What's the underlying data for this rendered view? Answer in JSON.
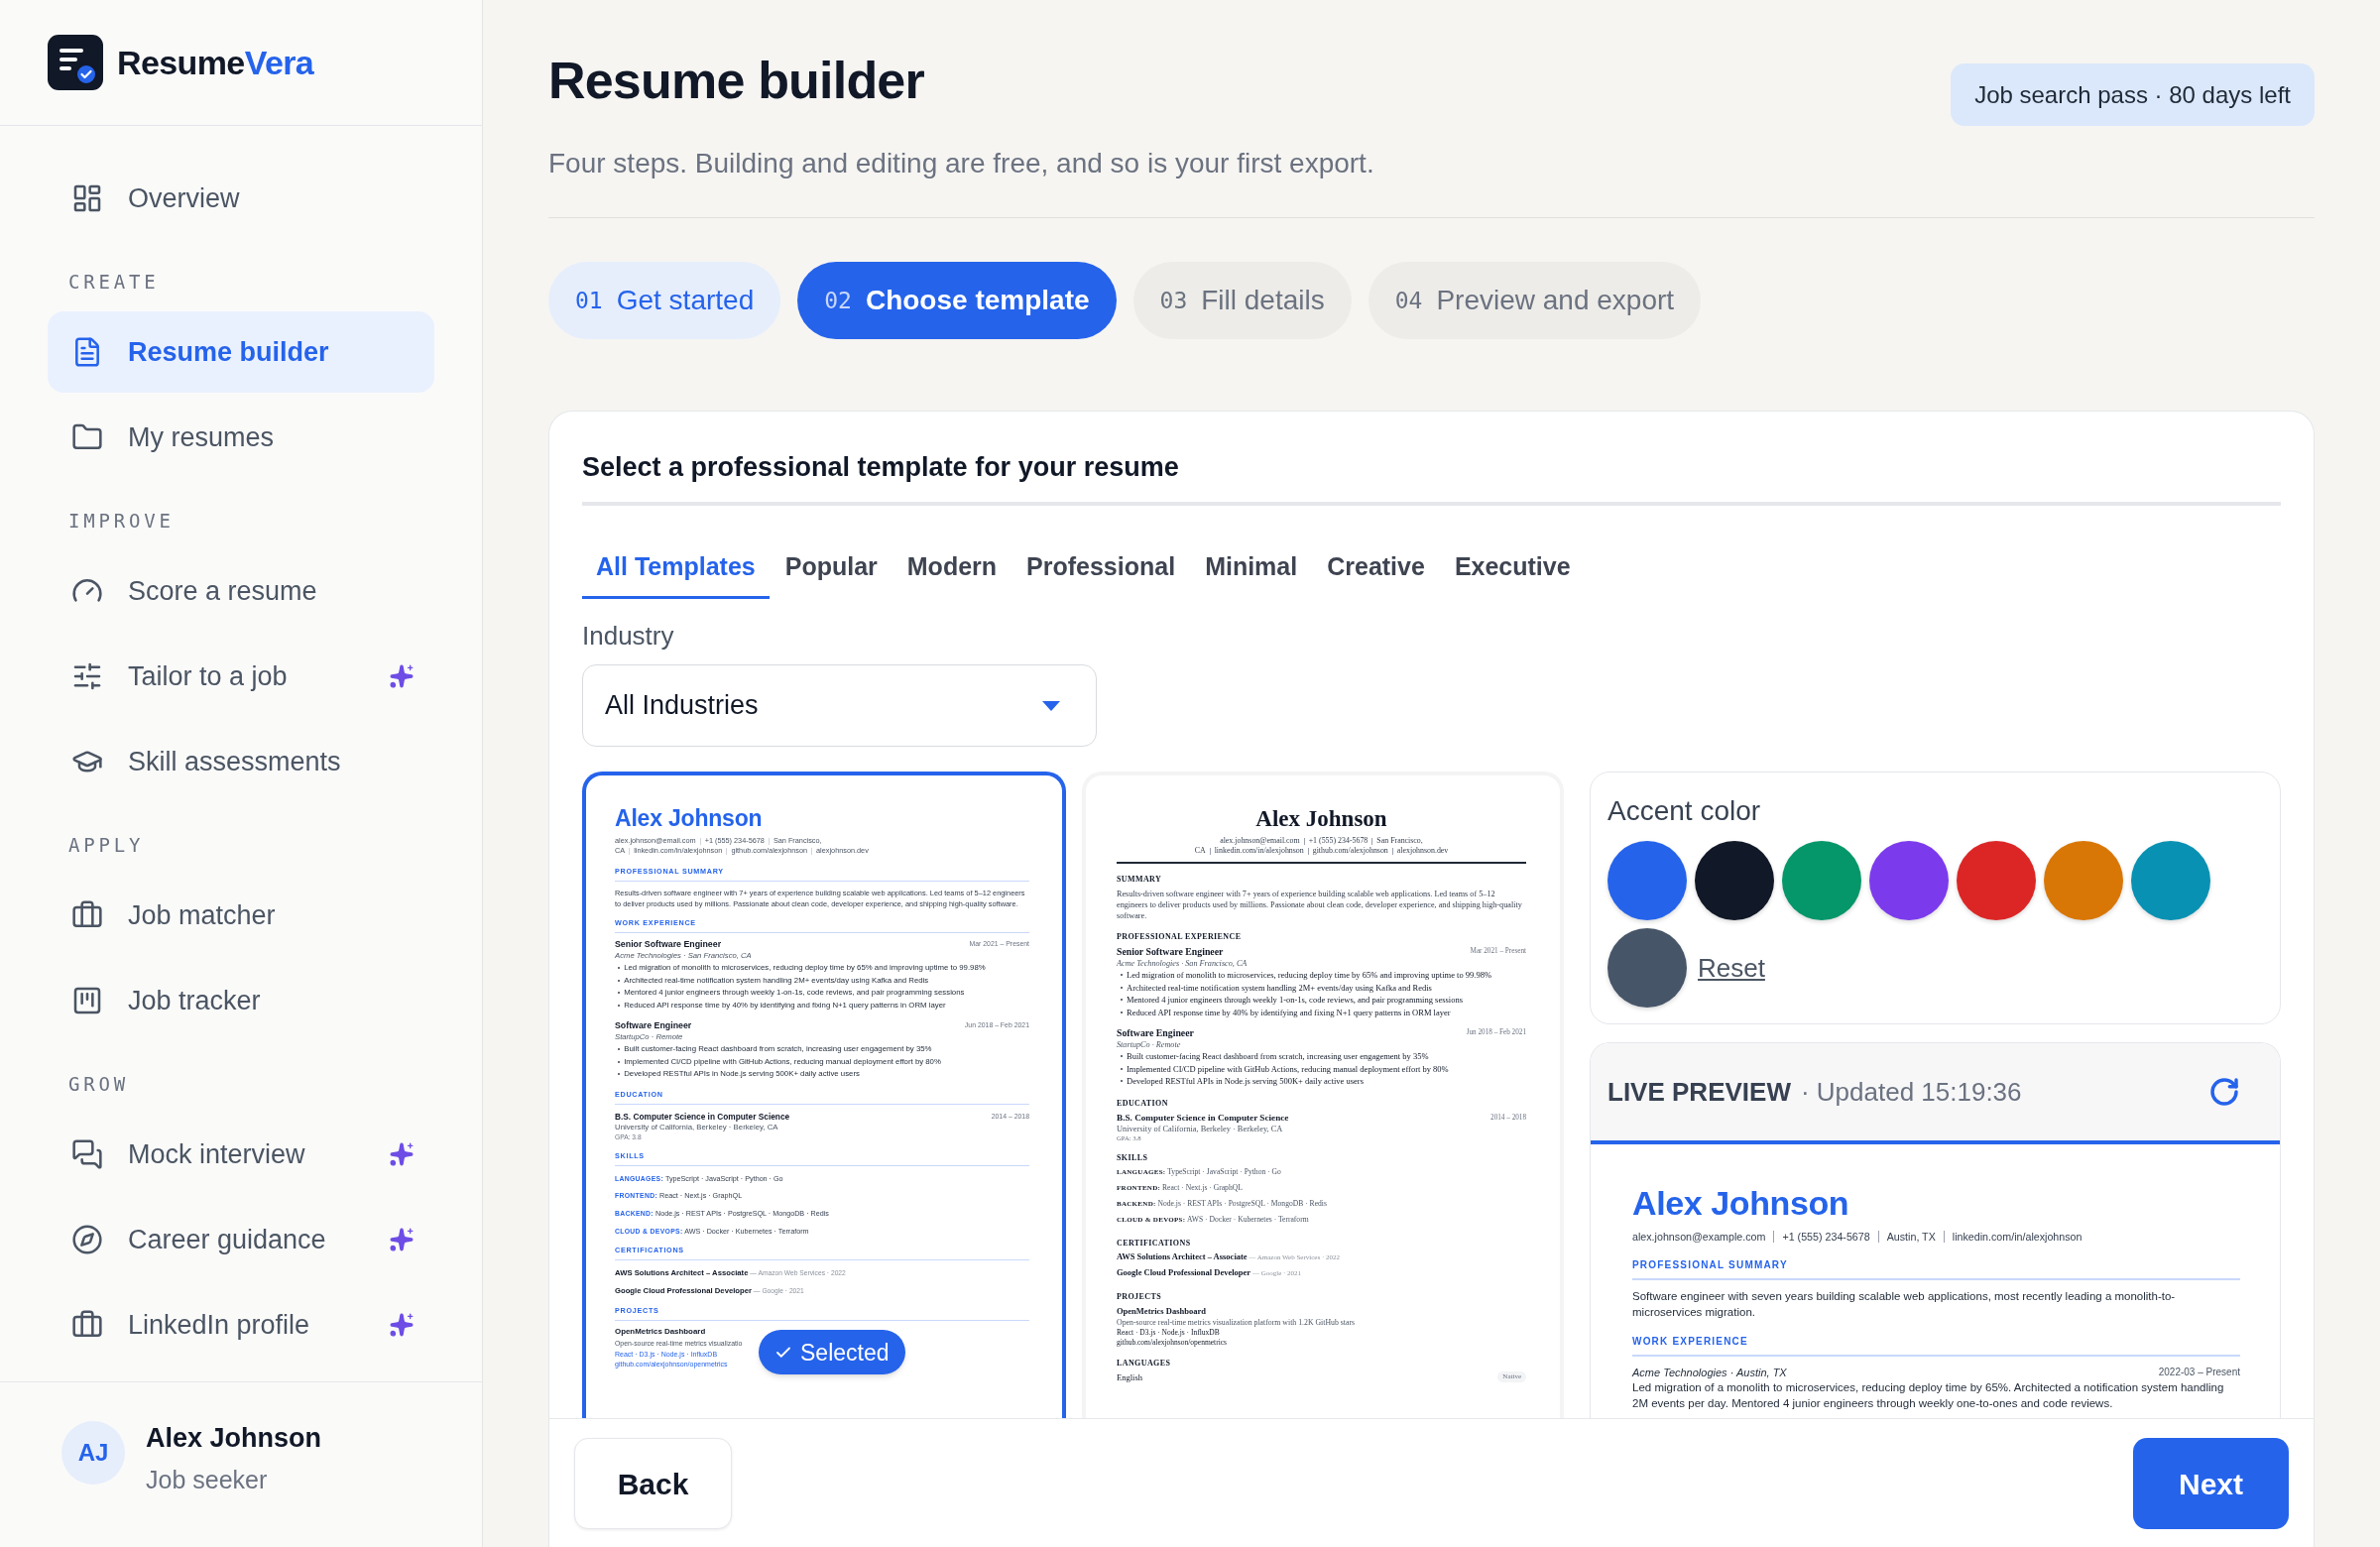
{
  "sidebar": {
    "brand": {
      "first": "Resume",
      "second": "Vera"
    },
    "sections": [
      {
        "items": [
          {
            "label": "Overview",
            "selected": false,
            "ai": false
          }
        ]
      },
      {
        "heading": "CREATE",
        "items": [
          {
            "label": "Resume builder",
            "selected": true,
            "ai": false
          },
          {
            "label": "My resumes",
            "selected": false,
            "ai": false
          }
        ]
      },
      {
        "heading": "IMPROVE",
        "items": [
          {
            "label": "Score a resume",
            "selected": false,
            "ai": false
          },
          {
            "label": "Tailor to a job",
            "selected": false,
            "ai": true
          },
          {
            "label": "Skill assessments",
            "selected": false,
            "ai": false
          }
        ]
      },
      {
        "heading": "APPLY",
        "items": [
          {
            "label": "Job matcher",
            "selected": false,
            "ai": false
          },
          {
            "label": "Job tracker",
            "selected": false,
            "ai": false
          }
        ]
      },
      {
        "heading": "GROW",
        "items": [
          {
            "label": "Mock interview",
            "selected": false,
            "ai": true
          },
          {
            "label": "Career guidance",
            "selected": false,
            "ai": true
          },
          {
            "label": "LinkedIn profile",
            "selected": false,
            "ai": true
          }
        ]
      }
    ],
    "user": {
      "initials": "AJ",
      "name": "Alex Johnson",
      "role": "Job seeker"
    }
  },
  "header": {
    "title": "Resume builder",
    "subtitle": "Four steps. Building and editing are free, and so is your first export.",
    "pass": "Job search pass · 80 days left"
  },
  "steps": [
    {
      "number": "01",
      "label": "Get started",
      "completed": true,
      "selected": false
    },
    {
      "number": "02",
      "label": "Choose template",
      "completed": false,
      "selected": true
    },
    {
      "number": "03",
      "label": "Fill details",
      "completed": false,
      "selected": false
    },
    {
      "number": "04",
      "label": "Preview and export",
      "completed": false,
      "selected": false
    }
  ],
  "template_picker": {
    "title": "Select a professional template for your resume",
    "tabs": [
      {
        "label": "All Templates",
        "selected": true
      },
      {
        "label": "Popular",
        "selected": false
      },
      {
        "label": "Modern",
        "selected": false
      },
      {
        "label": "Professional",
        "selected": false
      },
      {
        "label": "Minimal",
        "selected": false
      },
      {
        "label": "Creative",
        "selected": false
      },
      {
        "label": "Executive",
        "selected": false
      }
    ],
    "industry": {
      "label": "Industry",
      "value": "All Industries"
    },
    "templates": [
      {
        "kind": "modern",
        "selected": true,
        "badge": "Selected",
        "resume": {
          "name": "Alex Johnson",
          "contact_lines": [
            [
              "alex.johnson@email.com",
              "+1 (555) 234-5678",
              "San Francisco,"
            ],
            [
              "CA",
              "linkedin.com/in/alexjohnson",
              "github.com/alexjohnson",
              "alexjohnson.dev"
            ]
          ],
          "sections": [
            {
              "kind": "text",
              "heading": "PROFESSIONAL SUMMARY",
              "text": "Results-driven software engineer with 7+ years of experience building scalable web applications. Led teams of 5–12 engineers to deliver products used by millions. Passionate about clean code, developer experience, and shipping high-quality software."
            },
            {
              "kind": "jobs",
              "heading": "WORK EXPERIENCE",
              "items": [
                {
                  "title": "Senior Software Engineer",
                  "date": "Mar 2021 – Present",
                  "org": "Acme Technologies · San Francisco, CA",
                  "bullets": [
                    "Led migration of monolith to microservices, reducing deploy time by 65% and improving uptime to 99.98%",
                    "Architected real-time notification system handling 2M+ events/day using Kafka and Redis",
                    "Mentored 4 junior engineers through weekly 1-on-1s, code reviews, and pair programming sessions",
                    "Reduced API response time by 40% by identifying and fixing N+1 query patterns in ORM layer"
                  ]
                },
                {
                  "title": "Software Engineer",
                  "date": "Jun 2018 – Feb 2021",
                  "org": "StartupCo · Remote",
                  "bullets": [
                    "Built customer-facing React dashboard from scratch, increasing user engagement by 35%",
                    "Implemented CI/CD pipeline with GitHub Actions, reducing manual deployment effort by 80%",
                    "Developed RESTful APIs in Node.js serving 500K+ daily active users"
                  ]
                }
              ]
            },
            {
              "kind": "education",
              "heading": "EDUCATION",
              "items": [
                {
                  "degree": "B.S. Computer Science in Computer Science",
                  "date": "2014 – 2018",
                  "school": "University of California, Berkeley · Berkeley, CA",
                  "note": "GPA: 3.8"
                }
              ]
            },
            {
              "kind": "skills",
              "heading": "SKILLS",
              "lines": [
                "**LANGUAGES:** TypeScript · JavaScript · Python · Go",
                "**FRONTEND:** React · Next.js · GraphQL",
                "**BACKEND:** Node.js · REST APIs · PostgreSQL · MongoDB · Redis",
                "**CLOUD & DEVOPS:** AWS · Docker · Kubernetes · Terraform"
              ]
            },
            {
              "kind": "certifications",
              "heading": "CERTIFICATIONS",
              "lines": [
                "**AWS Solutions Architect – Associate** — Amazon Web Services · 2022",
                "**Google Cloud Professional Developer** — Google · 2021"
              ]
            },
            {
              "kind": "projects",
              "heading": "PROJECTS",
              "items": [
                {
                  "name": "OpenMetrics Dashboard",
                  "description": "Open-source real-time metrics visualizatio",
                  "tech": "React · D3.js · Node.js · InfluxDB",
                  "link": "github.com/alexjohnson/openmetrics"
                }
              ]
            }
          ]
        }
      },
      {
        "kind": "classic",
        "selected": false,
        "resume": {
          "name": "Alex Johnson",
          "contact_lines": [
            [
              "alex.johnson@email.com",
              "+1 (555) 234-5678",
              "San Francisco,"
            ],
            [
              "CA",
              "linkedin.com/in/alexjohnson",
              "github.com/alexjohnson",
              "alexjohnson.dev"
            ]
          ],
          "sections": [
            {
              "kind": "text",
              "heading": "SUMMARY",
              "text": "Results-driven software engineer with 7+ years of experience building scalable web applications. Led teams of 5–12 engineers to deliver products used by millions. Passionate about clean code, developer experience, and shipping high-quality software."
            },
            {
              "kind": "jobs",
              "heading": "PROFESSIONAL EXPERIENCE",
              "items": [
                {
                  "title": "Senior Software Engineer",
                  "date": "Mar 2021 – Present",
                  "org": "Acme Technologies · San Francisco, CA",
                  "bullets": [
                    "Led migration of monolith to microservices, reducing deploy time by 65% and improving uptime to 99.98%",
                    "Architected real-time notification system handling 2M+ events/day using Kafka and Redis",
                    "Mentored 4 junior engineers through weekly 1-on-1s, code reviews, and pair programming sessions",
                    "Reduced API response time by 40% by identifying and fixing N+1 query patterns in ORM layer"
                  ]
                },
                {
                  "title": "Software Engineer",
                  "date": "Jun 2018 – Feb 2021",
                  "org": "StartupCo · Remote",
                  "bullets": [
                    "Built customer-facing React dashboard from scratch, increasing user engagement by 35%",
                    "Implemented CI/CD pipeline with GitHub Actions, reducing manual deployment effort by 80%",
                    "Developed RESTful APIs in Node.js serving 500K+ daily active users"
                  ]
                }
              ]
            },
            {
              "kind": "education",
              "heading": "EDUCATION",
              "items": [
                {
                  "degree": "B.S. Computer Science in Computer Science",
                  "date": "2014 – 2018",
                  "school": "University of California, Berkeley · Berkeley, CA",
                  "note": "GPA: 3.8"
                }
              ]
            },
            {
              "kind": "skills",
              "heading": "SKILLS",
              "lines": [
                "**LANGUAGES:** TypeScript · JavaScript · Python · Go",
                "**FRONTEND:** React · Next.js · GraphQL",
                "**BACKEND:** Node.js · REST APIs · PostgreSQL · MongoDB · Redis",
                "**CLOUD & DEVOPS:** AWS · Docker · Kubernetes · Terraform"
              ]
            },
            {
              "kind": "certifications",
              "heading": "CERTIFICATIONS",
              "lines": [
                "**AWS Solutions Architect – Associate** — Amazon Web Services · 2022",
                "**Google Cloud Professional Developer** — Google · 2021"
              ]
            },
            {
              "kind": "projects",
              "heading": "PROJECTS",
              "items": [
                {
                  "name": "OpenMetrics Dashboard",
                  "description": "Open-source real-time metrics visualization platform with 1.2K GitHub stars",
                  "tech": "React · D3.js · Node.js · InfluxDB",
                  "link": "github.com/alexjohnson/openmetrics"
                }
              ]
            },
            {
              "kind": "languages",
              "heading": "LANGUAGES",
              "items": [
                {
                  "language": "English",
                  "level": "Native"
                }
              ]
            }
          ]
        }
      }
    ],
    "accent": {
      "title": "Accent color",
      "swatches": [
        {
          "color": "#2563eb"
        },
        {
          "color": "#111827"
        },
        {
          "color": "#059669"
        },
        {
          "color": "#7c3aed"
        },
        {
          "color": "#dc2626"
        },
        {
          "color": "#d97706"
        },
        {
          "color": "#0891b2"
        },
        {
          "color": "#475569"
        }
      ],
      "reset": "Reset"
    },
    "live_preview": {
      "title": "LIVE PREVIEW",
      "updated": "· Updated 15:19:36",
      "resume": {
        "name": "Alex Johnson",
        "contact_lines": [
          [
            "alex.johnson@example.com",
            "+1 (555) 234-5678",
            "Austin, TX",
            "linkedin.com/in/alexjohnson"
          ]
        ],
        "sections": [
          {
            "kind": "text",
            "heading": "PROFESSIONAL SUMMARY",
            "text": "Software engineer with seven years building scalable web applications, most recently leading a monolith-to-microservices migration."
          },
          {
            "kind": "jobs",
            "heading": "WORK EXPERIENCE",
            "items": [
              {
                "org": "Acme Technologies · Austin, TX",
                "date": "2022-03 – Present",
                "text": "Led migration of a monolith to microservices, reducing deploy time by 65%. Architected a notification system handling 2M events per day. Mentored 4 junior engineers through weekly one-to-ones and code reviews."
              }
            ]
          }
        ]
      }
    }
  },
  "footer": {
    "back": "Back",
    "next": "Next"
  }
}
